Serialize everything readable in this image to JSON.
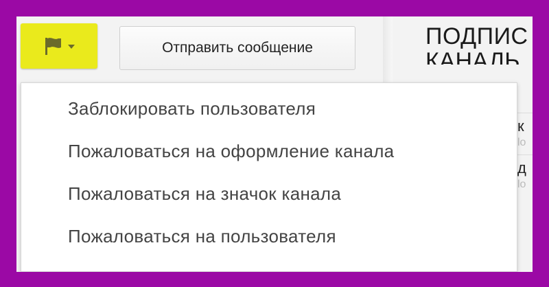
{
  "toolbar": {
    "flag_icon": "flag-icon",
    "send_message_label": "Отправить сообщение",
    "flag_button_color": "#eaea1c"
  },
  "page": {
    "title_line1": "ПОДПИС",
    "title_line2": "КАНАЛЬ",
    "side_col": [
      {
        "big": "к",
        "small": "lo"
      },
      {
        "big": "д",
        "small": "lo"
      }
    ]
  },
  "menu": {
    "items": [
      {
        "label": "Заблокировать пользователя"
      },
      {
        "label": "Пожаловаться на оформление канала"
      },
      {
        "label": "Пожаловаться на значок канала"
      },
      {
        "label": "Пожаловаться на пользователя"
      }
    ]
  },
  "colors": {
    "frame": "#9b09a5",
    "highlight": "#eaea1c"
  }
}
